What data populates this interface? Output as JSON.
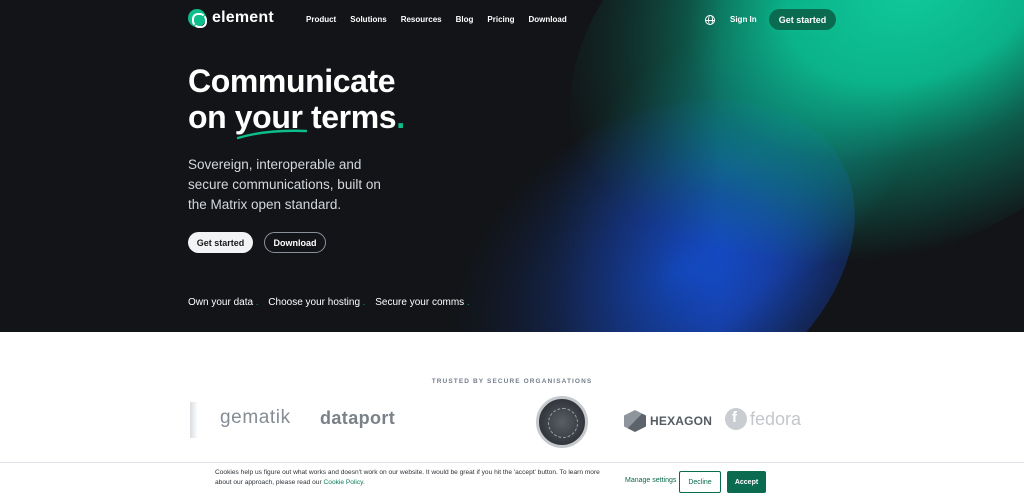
{
  "nav": {
    "brand": "element",
    "links": [
      "Product",
      "Solutions",
      "Resources",
      "Blog",
      "Pricing",
      "Download"
    ],
    "globe_icon": "globe-icon",
    "signin": "Sign In",
    "cta": "Get started"
  },
  "hero": {
    "headline_line1": "Communicate",
    "headline_line2": "on your terms",
    "headline_dot": ".",
    "subhead": "Sovereign, interoperable and secure communications, built on the Matrix open standard.",
    "primary_button": "Get started",
    "secondary_button": "Download",
    "features": [
      "Own your data",
      "Choose your hosting",
      "Secure your comms"
    ],
    "feature_dot": "."
  },
  "trusted": {
    "label": "TRUSTED BY SECURE ORGANISATIONS",
    "logos": {
      "gematik": "gematik",
      "dataport": "dataport",
      "hexagon": "HEXAGON",
      "fedora": "fedora"
    }
  },
  "cookie": {
    "text": "Cookies help us figure out what works and doesn't work on our website. It would be great if you hit the 'accept' button. To learn more about our approach, please read our ",
    "link": "Cookie Policy",
    "text_end": ".",
    "manage": "Manage settings",
    "decline": "Decline",
    "accept": "Accept"
  },
  "colors": {
    "brand_green": "#0dbd8b",
    "dark_bg": "#121417",
    "button_green": "#0b6b50"
  }
}
